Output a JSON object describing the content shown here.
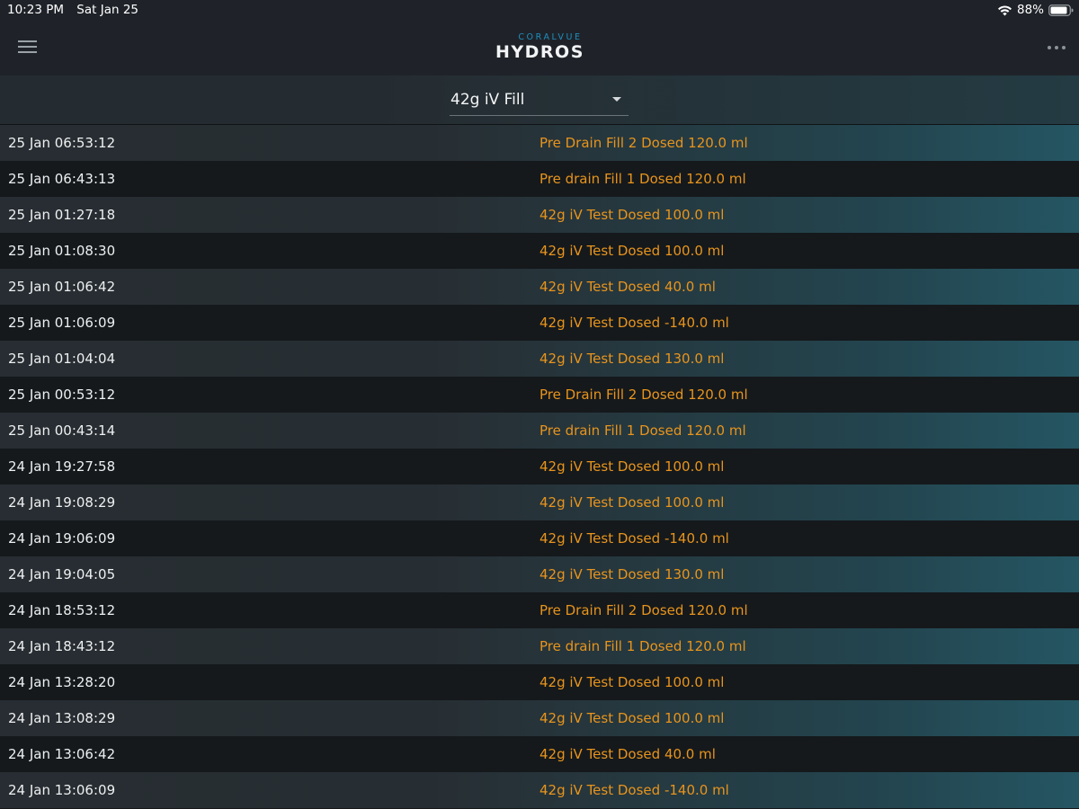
{
  "status_bar": {
    "time": "10:23 PM",
    "date": "Sat Jan 25",
    "battery": "88%"
  },
  "header": {
    "brand_small": "CORALVUE",
    "brand_big": "HYDROS"
  },
  "filter": {
    "selected": "42g iV Fill"
  },
  "colors": {
    "accent_orange": "#e8941c",
    "brand_blue": "#1f8fbf",
    "nav_bg": "#1f2329"
  },
  "log": [
    {
      "time": "25 Jan 06:53:12",
      "event": "Pre Drain Fill 2 Dosed 120.0 ml"
    },
    {
      "time": "25 Jan 06:43:13",
      "event": "Pre drain Fill 1 Dosed 120.0 ml"
    },
    {
      "time": "25 Jan 01:27:18",
      "event": "42g iV Test Dosed 100.0 ml"
    },
    {
      "time": "25 Jan 01:08:30",
      "event": "42g iV Test Dosed 100.0 ml"
    },
    {
      "time": "25 Jan 01:06:42",
      "event": "42g iV Test Dosed 40.0 ml"
    },
    {
      "time": "25 Jan 01:06:09",
      "event": "42g iV Test Dosed -140.0 ml"
    },
    {
      "time": "25 Jan 01:04:04",
      "event": "42g iV Test Dosed 130.0 ml"
    },
    {
      "time": "25 Jan 00:53:12",
      "event": "Pre Drain Fill 2 Dosed 120.0 ml"
    },
    {
      "time": "25 Jan 00:43:14",
      "event": "Pre drain Fill 1 Dosed 120.0 ml"
    },
    {
      "time": "24 Jan 19:27:58",
      "event": "42g iV Test Dosed 100.0 ml"
    },
    {
      "time": "24 Jan 19:08:29",
      "event": "42g iV Test Dosed 100.0 ml"
    },
    {
      "time": "24 Jan 19:06:09",
      "event": "42g iV Test Dosed -140.0 ml"
    },
    {
      "time": "24 Jan 19:04:05",
      "event": "42g iV Test Dosed 130.0 ml"
    },
    {
      "time": "24 Jan 18:53:12",
      "event": "Pre Drain Fill 2 Dosed 120.0 ml"
    },
    {
      "time": "24 Jan 18:43:12",
      "event": "Pre drain Fill 1 Dosed 120.0 ml"
    },
    {
      "time": "24 Jan 13:28:20",
      "event": "42g iV Test Dosed 100.0 ml"
    },
    {
      "time": "24 Jan 13:08:29",
      "event": "42g iV Test Dosed 100.0 ml"
    },
    {
      "time": "24 Jan 13:06:42",
      "event": "42g iV Test Dosed 40.0 ml"
    },
    {
      "time": "24 Jan 13:06:09",
      "event": "42g iV Test Dosed -140.0 ml"
    }
  ]
}
